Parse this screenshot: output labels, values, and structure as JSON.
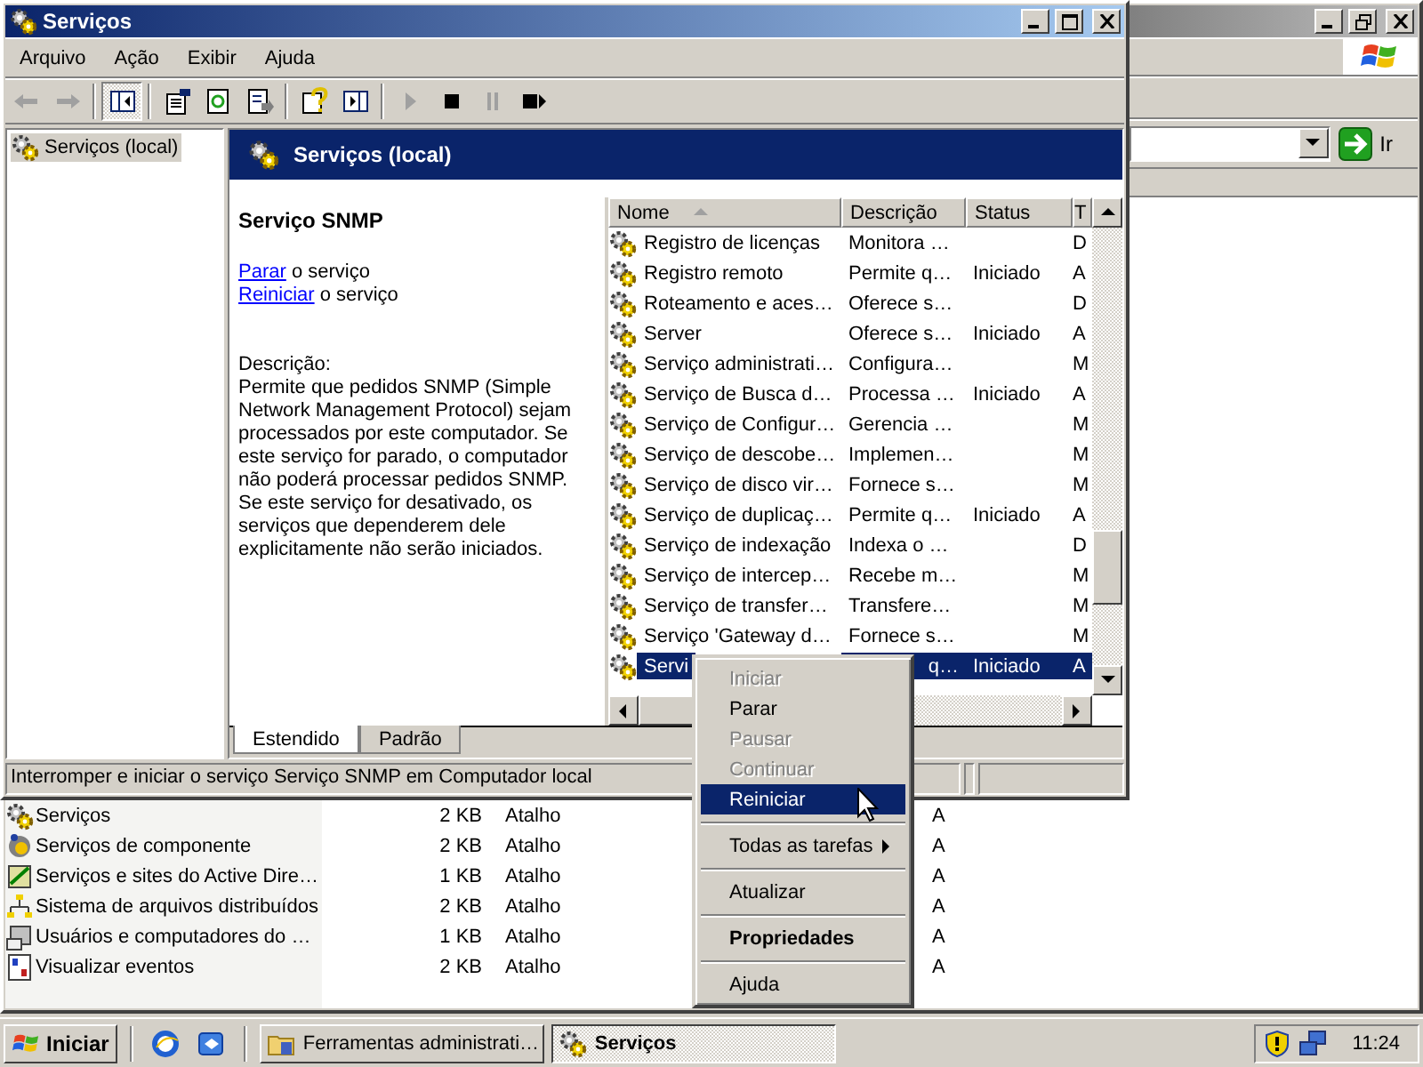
{
  "explorer_window": {
    "go_button": "Ir",
    "files": [
      {
        "name": "Serviços",
        "size": "2 KB",
        "type": "Atalho",
        "attributes": "A"
      },
      {
        "name": "Serviços de componente",
        "size": "2 KB",
        "type": "Atalho",
        "attributes": "A"
      },
      {
        "name": "Serviços e sites do Active Dire…",
        "size": "1 KB",
        "type": "Atalho",
        "attributes": "A"
      },
      {
        "name": "Sistema de arquivos distribuídos",
        "size": "2 KB",
        "type": "Atalho",
        "attributes": "A"
      },
      {
        "name": "Usuários e computadores do …",
        "size": "1 KB",
        "type": "Atalho",
        "attributes": "A"
      },
      {
        "name": "Visualizar eventos",
        "size": "2 KB",
        "type": "Atalho",
        "attributes": "A"
      }
    ]
  },
  "services_window": {
    "title": "Serviços",
    "menu": [
      "Arquivo",
      "Ação",
      "Exibir",
      "Ajuda"
    ],
    "tree": [
      {
        "label": "Serviços (local)",
        "selected": true
      }
    ],
    "header": "Serviços (local)",
    "service_name": "Serviço SNMP",
    "actions": [
      {
        "link": "Parar",
        "text": "o serviço"
      },
      {
        "link": "Reiniciar",
        "text": "o serviço"
      }
    ],
    "description_label": "Descrição:",
    "description": "Permite que pedidos SNMP (Simple Network Management Protocol) sejam processados por este computador. Se este serviço for parado, o computador não poderá processar pedidos SNMP. Se este serviço for desativado, os serviços que dependerem dele explicitamente não serão iniciados.",
    "columns": [
      "Nome",
      "Descrição",
      "Status",
      "T"
    ],
    "rows": [
      {
        "name": "Registro de licenças",
        "description": "Monitora …",
        "type": "D",
        "selected": false
      },
      {
        "name": "Registro remoto",
        "description": "Permite q…",
        "status": "Iniciado",
        "type": "A",
        "selected": false
      },
      {
        "name": "Roteamento e aces…",
        "description": "Oferece s…",
        "type": "D",
        "selected": false
      },
      {
        "name": "Server",
        "description": "Oferece s…",
        "status": "Iniciado",
        "type": "A",
        "selected": false
      },
      {
        "name": "Serviço administrati…",
        "description": "Configura…",
        "type": "M",
        "selected": false
      },
      {
        "name": "Serviço de Busca d…",
        "description": "Processa …",
        "status": "Iniciado",
        "type": "A",
        "selected": false
      },
      {
        "name": "Serviço de Configur…",
        "description": "Gerencia …",
        "type": "M",
        "selected": false
      },
      {
        "name": "Serviço de descobe…",
        "description": "Implemen…",
        "type": "M",
        "selected": false
      },
      {
        "name": "Serviço de disco vir…",
        "description": "Fornece s…",
        "type": "M",
        "selected": false
      },
      {
        "name": "Serviço de duplicaç…",
        "description": "Permite q…",
        "status": "Iniciado",
        "type": "A",
        "selected": false
      },
      {
        "name": "Serviço de indexação",
        "description": "Indexa o …",
        "type": "D",
        "selected": false
      },
      {
        "name": "Serviço de intercep…",
        "description": "Recebe m…",
        "type": "M",
        "selected": false
      },
      {
        "name": "Serviço de transfer…",
        "description": "Transfere…",
        "type": "M",
        "selected": false
      },
      {
        "name": "Serviço 'Gateway d…",
        "description": "Fornece s…",
        "type": "M",
        "selected": false
      },
      {
        "name": "Servi",
        "description": "q…",
        "status": "Iniciado",
        "type": "A",
        "selected": true
      }
    ],
    "view_tabs": [
      {
        "label": "Estendido",
        "selected": true
      },
      {
        "label": "Padrão",
        "selected": false
      }
    ],
    "status_bar": "Interromper e iniciar o serviço Serviço SNMP em Computador local"
  },
  "context_menu": {
    "items": [
      {
        "kind": "item",
        "label": "Iniciar",
        "disabled": true,
        "highlighted": false
      },
      {
        "kind": "item",
        "label": "Parar",
        "disabled": false,
        "highlighted": false
      },
      {
        "kind": "item",
        "label": "Pausar",
        "disabled": true,
        "highlighted": false
      },
      {
        "kind": "item",
        "label": "Continuar",
        "disabled": true,
        "highlighted": false
      },
      {
        "kind": "item",
        "label": "Reiniciar",
        "disabled": false,
        "highlighted": true
      },
      {
        "kind": "separator"
      },
      {
        "kind": "submenu",
        "label": "Todas as tarefas",
        "disabled": false,
        "highlighted": false
      },
      {
        "kind": "separator"
      },
      {
        "kind": "item",
        "label": "Atualizar",
        "disabled": false,
        "highlighted": false
      },
      {
        "kind": "separator"
      },
      {
        "kind": "default",
        "label": "Propriedades",
        "disabled": false,
        "highlighted": false
      },
      {
        "kind": "separator"
      },
      {
        "kind": "item",
        "label": "Ajuda",
        "disabled": false,
        "highlighted": false
      }
    ]
  },
  "taskbar": {
    "start": "Iniciar",
    "tasks": [
      {
        "label": "Ferramentas administrati…",
        "selected": false
      },
      {
        "label": "Serviços",
        "selected": true
      }
    ],
    "clock": "11:24"
  }
}
